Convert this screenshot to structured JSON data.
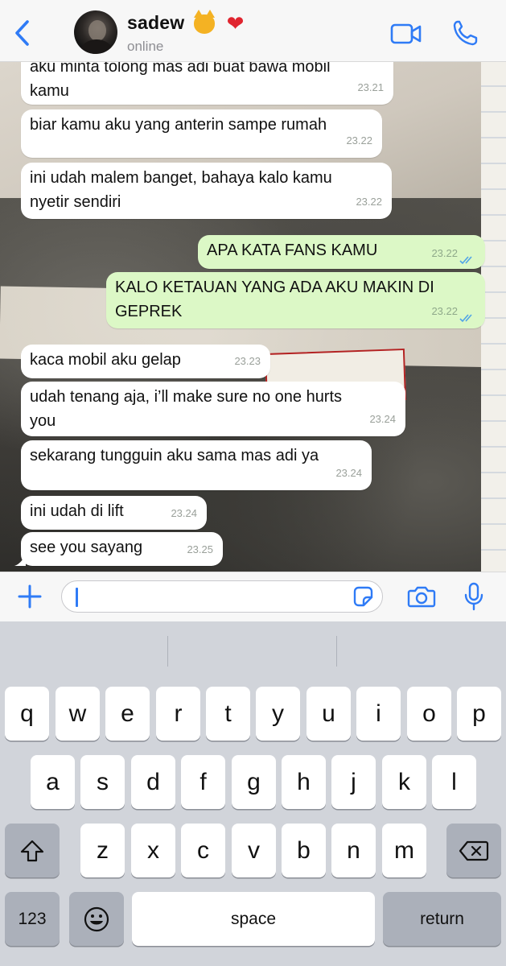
{
  "header": {
    "contact_name": "sadew",
    "status": "online",
    "emoji": [
      "angry-cat-emoji",
      "heart-on-fire-emoji"
    ]
  },
  "messages": [
    {
      "direction": "in",
      "lines": [
        "aku minta tolong mas adi buat bawa mobil",
        "kamu"
      ],
      "time": "23.21"
    },
    {
      "direction": "in",
      "lines": [
        "biar kamu aku yang anterin sampe rumah"
      ],
      "time": "23.22"
    },
    {
      "direction": "in",
      "lines": [
        "ini udah malem banget, bahaya kalo kamu",
        "nyetir sendiri"
      ],
      "time": "23.22"
    },
    {
      "direction": "out",
      "lines": [
        "APA KATA FANS KAMU"
      ],
      "time": "23.22",
      "read": true
    },
    {
      "direction": "out",
      "lines": [
        "KALO KETAUAN YANG ADA AKU MAKIN DI",
        "GEPREK"
      ],
      "time": "23.22",
      "read": true
    },
    {
      "direction": "in",
      "lines": [
        "kaca mobil aku gelap"
      ],
      "time": "23.23"
    },
    {
      "direction": "in",
      "lines": [
        "udah tenang aja, i’ll make sure no one hurts",
        "you"
      ],
      "time": "23.24"
    },
    {
      "direction": "in",
      "lines": [
        "sekarang tungguin aku sama mas adi ya"
      ],
      "time": "23.24"
    },
    {
      "direction": "in",
      "lines": [
        "ini udah di lift"
      ],
      "time": "23.24"
    },
    {
      "direction": "in",
      "lines": [
        "see you sayang"
      ],
      "time": "23.25"
    }
  ],
  "input": {
    "value": "",
    "placeholder": ""
  },
  "keyboard": {
    "row1": [
      "q",
      "w",
      "e",
      "r",
      "t",
      "y",
      "u",
      "i",
      "o",
      "p"
    ],
    "row2": [
      "a",
      "s",
      "d",
      "f",
      "g",
      "h",
      "j",
      "k",
      "l"
    ],
    "row3": [
      "z",
      "x",
      "c",
      "v",
      "b",
      "n",
      "m"
    ],
    "numbers_key": "123",
    "space_key": "space",
    "return_key": "return"
  },
  "colors": {
    "accent": "#2f7bf6",
    "outgoing_bubble": "#dcf8c6",
    "incoming_bubble": "#ffffff",
    "read_ticks": "#4fa3e8"
  }
}
